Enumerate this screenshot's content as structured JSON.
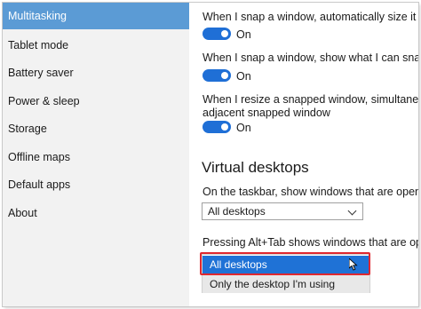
{
  "sidebar": {
    "items": [
      {
        "label": "Multitasking",
        "selected": true
      },
      {
        "label": "Tablet mode",
        "selected": false
      },
      {
        "label": "Battery saver",
        "selected": false
      },
      {
        "label": "Power & sleep",
        "selected": false
      },
      {
        "label": "Storage",
        "selected": false
      },
      {
        "label": "Offline maps",
        "selected": false
      },
      {
        "label": "Default apps",
        "selected": false
      },
      {
        "label": "About",
        "selected": false
      }
    ]
  },
  "snap": {
    "items": [
      {
        "description_lines": [
          "When I snap a window, automatically size it to fill availa"
        ],
        "toggle_state": "On",
        "toggle_on": true
      },
      {
        "description_lines": [
          "When I snap a window, show what I can snap next to it"
        ],
        "toggle_state": "On",
        "toggle_on": true
      },
      {
        "description_lines": [
          "When I resize a snapped window, simultaneously resize",
          "adjacent snapped window"
        ],
        "toggle_state": "On",
        "toggle_on": true
      }
    ]
  },
  "virtual_desktops": {
    "title": "Virtual desktops",
    "taskbar_label": "On the taskbar, show windows that are open on",
    "taskbar_value": "All desktops",
    "alttab_label": "Pressing Alt+Tab shows windows that are open on",
    "alttab_options": [
      "All desktops",
      "Only the desktop I'm using"
    ],
    "alttab_highlighted": "All desktops"
  },
  "colors": {
    "accent": "#1f6fd6",
    "sidebar_selected": "#5b9bd5",
    "annotation_border": "#e0282f"
  },
  "icons": {
    "dropdown": "chevron-down-icon",
    "pointer": "mouse-cursor-icon"
  }
}
